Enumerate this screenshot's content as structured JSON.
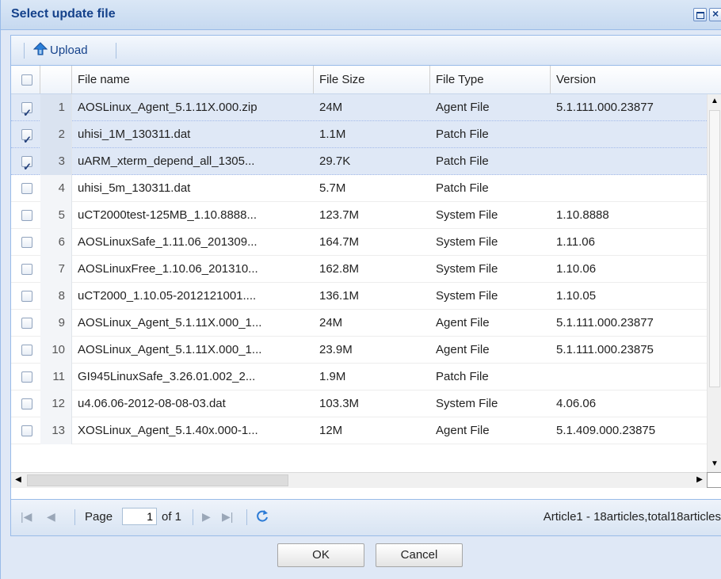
{
  "dialog": {
    "title": "Select update file"
  },
  "toolbar": {
    "upload_label": "Upload"
  },
  "grid": {
    "columns": {
      "file_name": "File name",
      "file_size": "File Size",
      "file_type": "File Type",
      "version": "Version"
    },
    "rows": [
      {
        "num": "1",
        "checked": true,
        "name": "AOSLinux_Agent_5.1.11X.000.zip",
        "size": "24M",
        "type": "Agent File",
        "version": "5.1.111.000.23877"
      },
      {
        "num": "2",
        "checked": true,
        "name": "uhisi_1M_130311.dat",
        "size": "1.1M",
        "type": "Patch File",
        "version": ""
      },
      {
        "num": "3",
        "checked": true,
        "name": "uARM_xterm_depend_all_1305...",
        "size": "29.7K",
        "type": "Patch File",
        "version": ""
      },
      {
        "num": "4",
        "checked": false,
        "name": "uhisi_5m_130311.dat",
        "size": "5.7M",
        "type": "Patch File",
        "version": ""
      },
      {
        "num": "5",
        "checked": false,
        "name": "uCT2000test-125MB_1.10.8888...",
        "size": "123.7M",
        "type": "System File",
        "version": "1.10.8888"
      },
      {
        "num": "6",
        "checked": false,
        "name": "AOSLinuxSafe_1.11.06_201309...",
        "size": "164.7M",
        "type": "System File",
        "version": "1.11.06"
      },
      {
        "num": "7",
        "checked": false,
        "name": "AOSLinuxFree_1.10.06_201310...",
        "size": "162.8M",
        "type": "System File",
        "version": "1.10.06"
      },
      {
        "num": "8",
        "checked": false,
        "name": "uCT2000_1.10.05-2012121001....",
        "size": "136.1M",
        "type": "System File",
        "version": "1.10.05"
      },
      {
        "num": "9",
        "checked": false,
        "name": "AOSLinux_Agent_5.1.11X.000_1...",
        "size": "24M",
        "type": "Agent File",
        "version": "5.1.111.000.23877"
      },
      {
        "num": "10",
        "checked": false,
        "name": "AOSLinux_Agent_5.1.11X.000_1...",
        "size": "23.9M",
        "type": "Agent File",
        "version": "5.1.111.000.23875"
      },
      {
        "num": "11",
        "checked": false,
        "name": "GI945LinuxSafe_3.26.01.002_2...",
        "size": "1.9M",
        "type": "Patch File",
        "version": ""
      },
      {
        "num": "12",
        "checked": false,
        "name": "u4.06.06-2012-08-08-03.dat",
        "size": "103.3M",
        "type": "System File",
        "version": "4.06.06"
      },
      {
        "num": "13",
        "checked": false,
        "name": "XOSLinux_Agent_5.1.40x.000-1...",
        "size": "12M",
        "type": "Agent File",
        "version": "5.1.409.000.23875"
      }
    ]
  },
  "paging": {
    "page_label": "Page",
    "page_value": "1",
    "of_label": "of 1",
    "info": "Article1 - 18articles,total18articles"
  },
  "buttons": {
    "ok": "OK",
    "cancel": "Cancel"
  }
}
